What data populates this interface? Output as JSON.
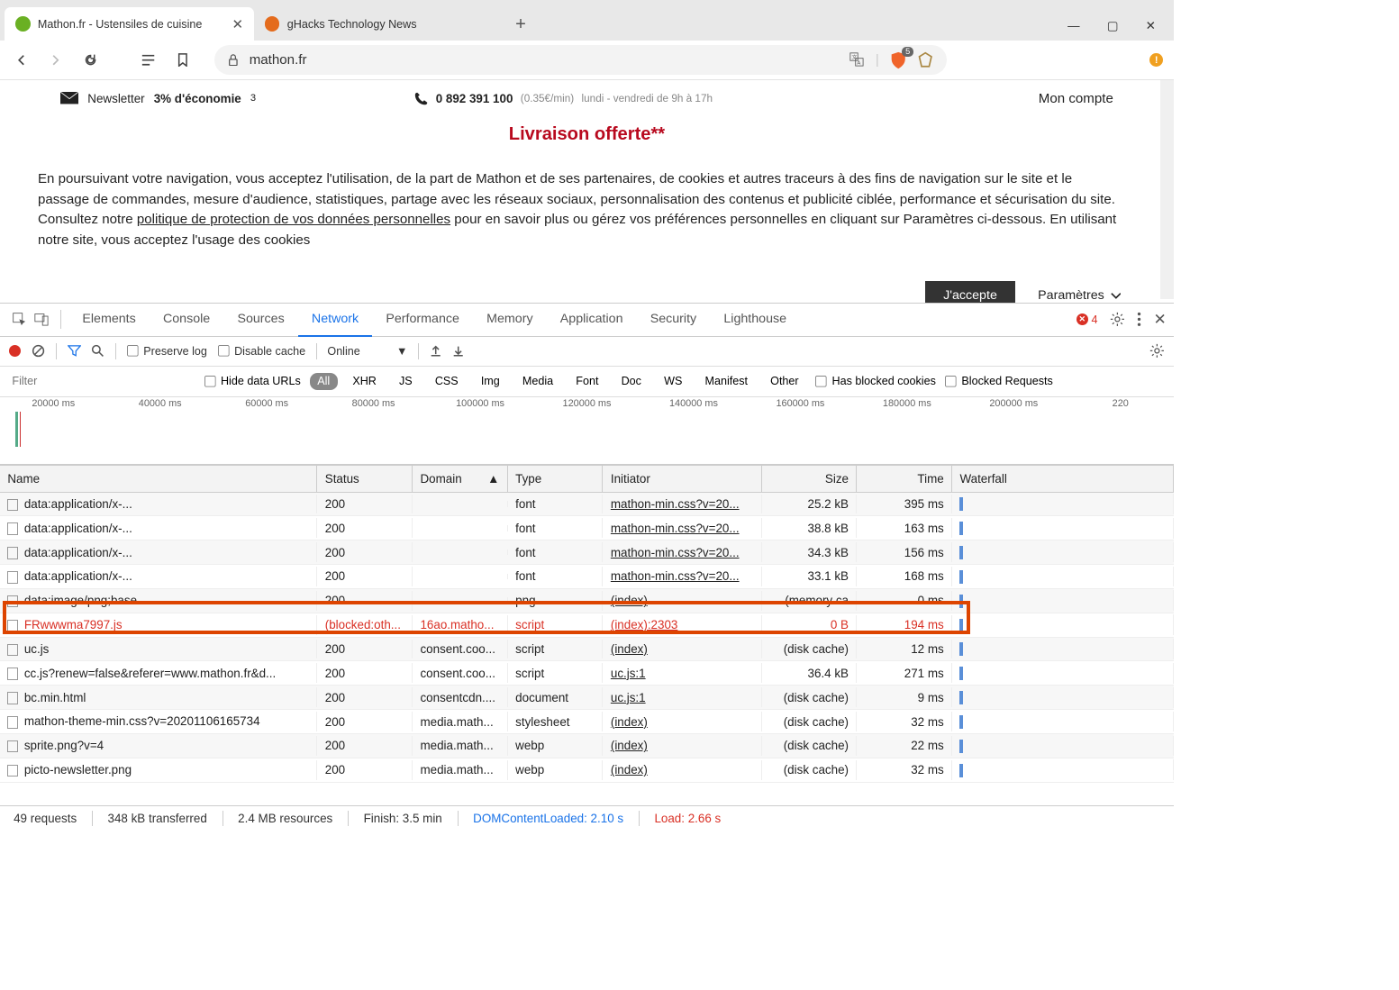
{
  "window": {
    "tabs": [
      {
        "title": "Mathon.fr - Ustensiles de cuisine",
        "favicon_color": "#6ab023",
        "active": true
      },
      {
        "title": "gHacks Technology News",
        "favicon_color": "#e46b1c",
        "active": false
      }
    ]
  },
  "toolbar": {
    "url_host": "mathon.fr",
    "shield_count": "5"
  },
  "page": {
    "newsletter_label": "Newsletter",
    "newsletter_bold": "3% d'économie",
    "newsletter_sup": "3",
    "phone_number": "0 892 391 100",
    "phone_rate": "(0.35€/min)",
    "phone_hours": "lundi - vendredi de 9h à 17h",
    "account_label": "Mon compte",
    "promo": "Livraison offerte**"
  },
  "cookie": {
    "text_pre": "En poursuivant votre navigation, vous acceptez l'utilisation, de la part de Mathon et de ses partenaires, de cookies et autres traceurs à des fins de navigation sur le site et le passage de commandes, mesure d'audience, statistiques, partage avec les réseaux sociaux, personnalisation des contenus et publicité ciblée, performance et sécurisation du site. Consultez notre ",
    "text_link": "politique de protection de vos données personnelles",
    "text_post": " pour en savoir plus ou gérez vos préférences personnelles en cliquant sur Paramètres ci-dessous. En utilisant notre site, vous acceptez l'usage des cookies",
    "accept": "J'accepte",
    "params": "Paramètres"
  },
  "devtools": {
    "tabs": [
      "Elements",
      "Console",
      "Sources",
      "Network",
      "Performance",
      "Memory",
      "Application",
      "Security",
      "Lighthouse"
    ],
    "active_tab": "Network",
    "error_count": "4",
    "net_toolbar": {
      "preserve_log": "Preserve log",
      "disable_cache": "Disable cache",
      "throttle": "Online"
    },
    "filter": {
      "placeholder": "Filter",
      "hide_data_urls": "Hide data URLs",
      "categories": [
        "All",
        "XHR",
        "JS",
        "CSS",
        "Img",
        "Media",
        "Font",
        "Doc",
        "WS",
        "Manifest",
        "Other"
      ],
      "has_blocked": "Has blocked cookies",
      "blocked_req": "Blocked Requests"
    },
    "overview_ticks": [
      "20000 ms",
      "40000 ms",
      "60000 ms",
      "80000 ms",
      "100000 ms",
      "120000 ms",
      "140000 ms",
      "160000 ms",
      "180000 ms",
      "200000 ms",
      "220"
    ],
    "columns": [
      "Name",
      "Status",
      "Domain",
      "Type",
      "Initiator",
      "Size",
      "Time",
      "Waterfall"
    ],
    "rows": [
      {
        "name": "data:application/x-...",
        "status": "200",
        "domain": "",
        "type": "font",
        "initiator": "mathon-min.css?v=20...",
        "size": "25.2 kB",
        "time": "395 ms",
        "blocked": false
      },
      {
        "name": "data:application/x-...",
        "status": "200",
        "domain": "",
        "type": "font",
        "initiator": "mathon-min.css?v=20...",
        "size": "38.8 kB",
        "time": "163 ms",
        "blocked": false
      },
      {
        "name": "data:application/x-...",
        "status": "200",
        "domain": "",
        "type": "font",
        "initiator": "mathon-min.css?v=20...",
        "size": "34.3 kB",
        "time": "156 ms",
        "blocked": false
      },
      {
        "name": "data:application/x-...",
        "status": "200",
        "domain": "",
        "type": "font",
        "initiator": "mathon-min.css?v=20...",
        "size": "33.1 kB",
        "time": "168 ms",
        "blocked": false
      },
      {
        "name": "data:image/png;base",
        "status": "200",
        "domain": "",
        "type": "png",
        "initiator": "(index)",
        "size": "(memory ca",
        "time": "0 ms",
        "blocked": false
      },
      {
        "name": "FRwwwma7997.js",
        "status": "(blocked:oth...",
        "domain": "16ao.matho...",
        "type": "script",
        "initiator": "(index):2303",
        "size": "0 B",
        "time": "194 ms",
        "blocked": true
      },
      {
        "name": "uc.js",
        "status": "200",
        "domain": "consent.coo...",
        "type": "script",
        "initiator": "(index)",
        "size": "(disk cache)",
        "time": "12 ms",
        "blocked": false
      },
      {
        "name": "cc.js?renew=false&referer=www.mathon.fr&d...",
        "status": "200",
        "domain": "consent.coo...",
        "type": "script",
        "initiator": "uc.js:1",
        "size": "36.4 kB",
        "time": "271 ms",
        "blocked": false
      },
      {
        "name": "bc.min.html",
        "status": "200",
        "domain": "consentcdn....",
        "type": "document",
        "initiator": "uc.js:1",
        "size": "(disk cache)",
        "time": "9 ms",
        "blocked": false
      },
      {
        "name": "mathon-theme-min.css?v=20201106165734",
        "status": "200",
        "domain": "media.math...",
        "type": "stylesheet",
        "initiator": "(index)",
        "size": "(disk cache)",
        "time": "32 ms",
        "blocked": false
      },
      {
        "name": "sprite.png?v=4",
        "status": "200",
        "domain": "media.math...",
        "type": "webp",
        "initiator": "(index)",
        "size": "(disk cache)",
        "time": "22 ms",
        "blocked": false
      },
      {
        "name": "picto-newsletter.png",
        "status": "200",
        "domain": "media.math...",
        "type": "webp",
        "initiator": "(index)",
        "size": "(disk cache)",
        "time": "32 ms",
        "blocked": false
      }
    ],
    "status": {
      "requests": "49 requests",
      "transferred": "348 kB transferred",
      "resources": "2.4 MB resources",
      "finish": "Finish: 3.5 min",
      "dcl": "DOMContentLoaded: 2.10 s",
      "load": "Load: 2.66 s"
    }
  }
}
